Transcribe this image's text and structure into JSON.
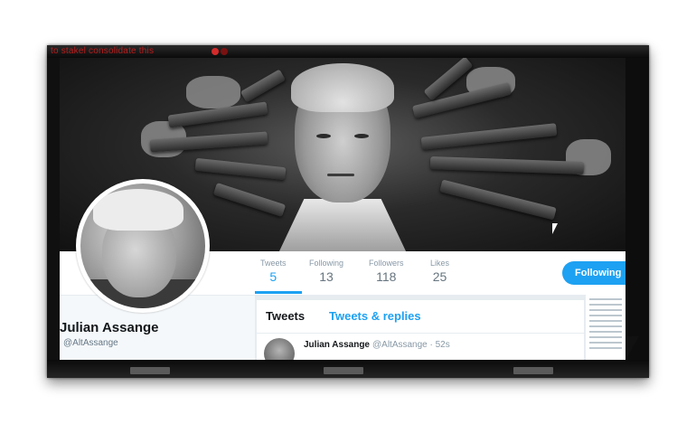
{
  "overlay": {
    "text": "to stakel consolidate this"
  },
  "profile": {
    "name": "Julian Assange",
    "handle": "@AltAssange"
  },
  "stats": [
    {
      "label": "Tweets",
      "value": "5"
    },
    {
      "label": "Following",
      "value": "13"
    },
    {
      "label": "Followers",
      "value": "118"
    },
    {
      "label": "Likes",
      "value": "25"
    }
  ],
  "follow_button": "Following",
  "tabs": {
    "tweets": "Tweets",
    "replies": "Tweets & replies"
  },
  "tweet": {
    "name": "Julian Assange",
    "meta": "@AltAssange · 52s"
  },
  "colors": {
    "accent": "#1da1f2",
    "frame": "#101010"
  }
}
